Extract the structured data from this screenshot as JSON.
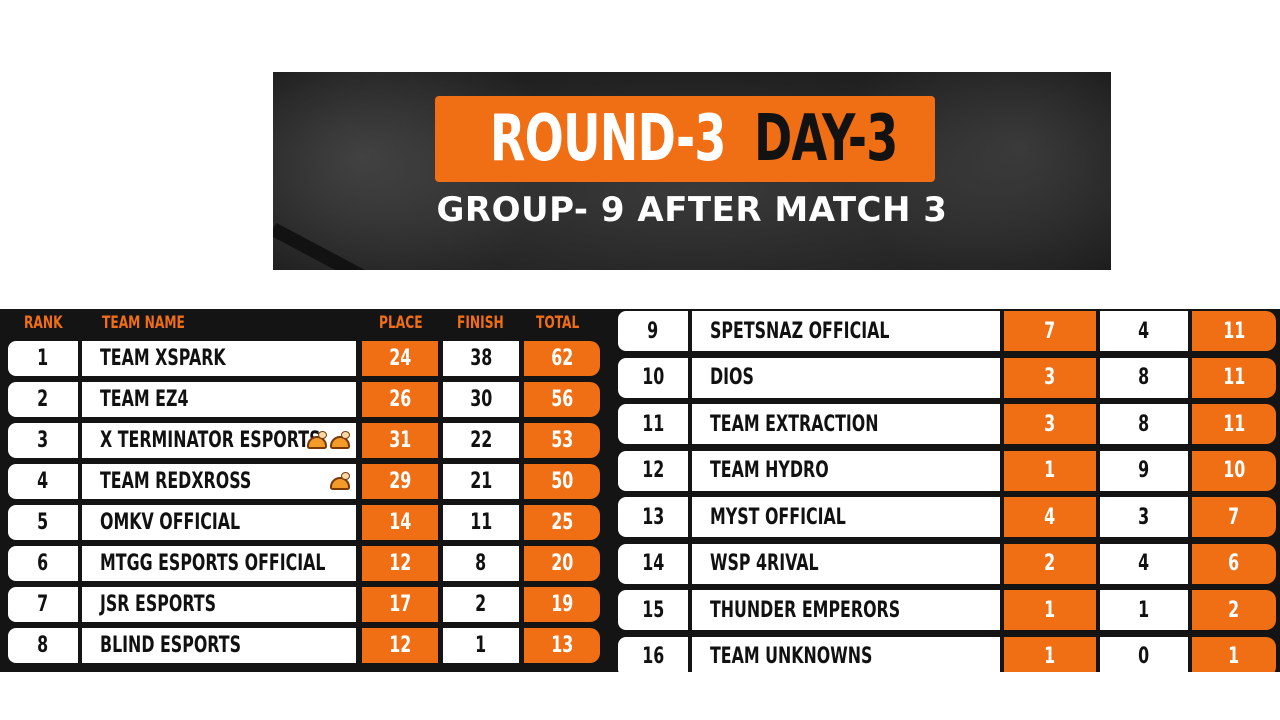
{
  "banner": {
    "round_label": "ROUND-3",
    "day_label": "DAY-3",
    "subtitle": "GROUP- 9 AFTER MATCH 3"
  },
  "colors": {
    "accent": "#f06e14",
    "dark": "#141414",
    "cell_bg": "#ffffff"
  },
  "table": {
    "headers": {
      "rank": "RANK",
      "team_name": "TEAM NAME",
      "place": "PLACE",
      "finish": "FINISH",
      "total": "TOTAL"
    },
    "left_rows": [
      {
        "rank": "1",
        "team": "TEAM XSPARK",
        "place": "24",
        "finish": "38",
        "total": "62",
        "chicken_dinners": 0
      },
      {
        "rank": "2",
        "team": "TEAM EZ4",
        "place": "26",
        "finish": "30",
        "total": "56",
        "chicken_dinners": 0
      },
      {
        "rank": "3",
        "team": "X TERMINATOR ESPORTS",
        "place": "31",
        "finish": "22",
        "total": "53",
        "chicken_dinners": 2
      },
      {
        "rank": "4",
        "team": "TEAM REDXROSS",
        "place": "29",
        "finish": "21",
        "total": "50",
        "chicken_dinners": 1
      },
      {
        "rank": "5",
        "team": "OMKV OFFICIAL",
        "place": "14",
        "finish": "11",
        "total": "25",
        "chicken_dinners": 0
      },
      {
        "rank": "6",
        "team": "MTGG ESPORTS OFFICIAL",
        "place": "12",
        "finish": "8",
        "total": "20",
        "chicken_dinners": 0
      },
      {
        "rank": "7",
        "team": "JSR ESPORTS",
        "place": "17",
        "finish": "2",
        "total": "19",
        "chicken_dinners": 0
      },
      {
        "rank": "8",
        "team": "BLIND ESPORTS",
        "place": "12",
        "finish": "1",
        "total": "13",
        "chicken_dinners": 0
      }
    ],
    "right_rows": [
      {
        "rank": "9",
        "team": "SPETSNAZ OFFICIAL",
        "place": "7",
        "finish": "4",
        "total": "11"
      },
      {
        "rank": "10",
        "team": "DIOS",
        "place": "3",
        "finish": "8",
        "total": "11"
      },
      {
        "rank": "11",
        "team": "TEAM EXTRACTION",
        "place": "3",
        "finish": "8",
        "total": "11"
      },
      {
        "rank": "12",
        "team": "TEAM HYDRO",
        "place": "1",
        "finish": "9",
        "total": "10"
      },
      {
        "rank": "13",
        "team": "MYST OFFICIAL",
        "place": "4",
        "finish": "3",
        "total": "7"
      },
      {
        "rank": "14",
        "team": "WSP  4RIVAL",
        "place": "2",
        "finish": "4",
        "total": "6"
      },
      {
        "rank": "15",
        "team": "THUNDER EMPERORS",
        "place": "1",
        "finish": "1",
        "total": "2"
      },
      {
        "rank": "16",
        "team": "TEAM UNKNOWNS",
        "place": "1",
        "finish": "0",
        "total": "1"
      }
    ],
    "icon": "chicken-dinner-icon"
  }
}
